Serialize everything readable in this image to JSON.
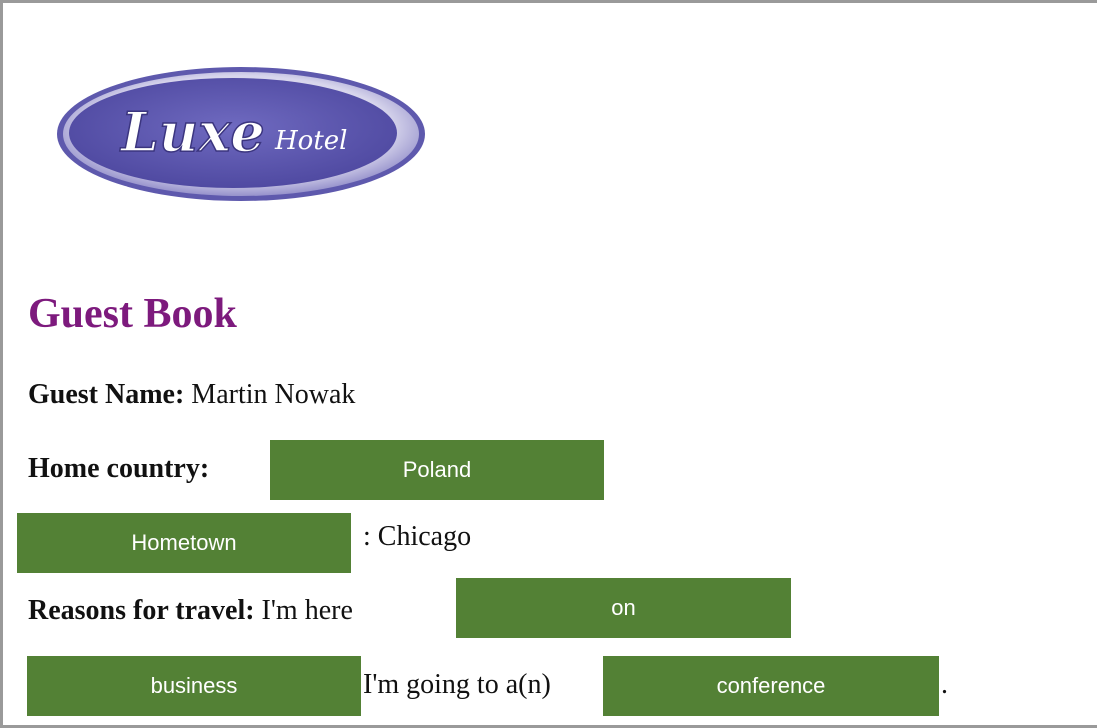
{
  "logo": {
    "text_main": "Luxe",
    "text_sub": "Hotel"
  },
  "page": {
    "title": "Guest Book"
  },
  "guest_name": {
    "label": "Guest Name:",
    "value": "Martin Nowak"
  },
  "home_country": {
    "label": "Home country:",
    "answer": "Poland"
  },
  "hometown": {
    "answer": "Hometown",
    "value_text": ": Chicago"
  },
  "reasons": {
    "label": "Reasons for travel:",
    "text_before": "I'm here",
    "answer_1": "on",
    "answer_2": "business",
    "text_middle": "I'm going to a(n)",
    "answer_3": "conference",
    "text_end": "."
  },
  "colors": {
    "title": "#7d1a7d",
    "chip": "#538135",
    "logo_fill": "#5a55b0"
  }
}
